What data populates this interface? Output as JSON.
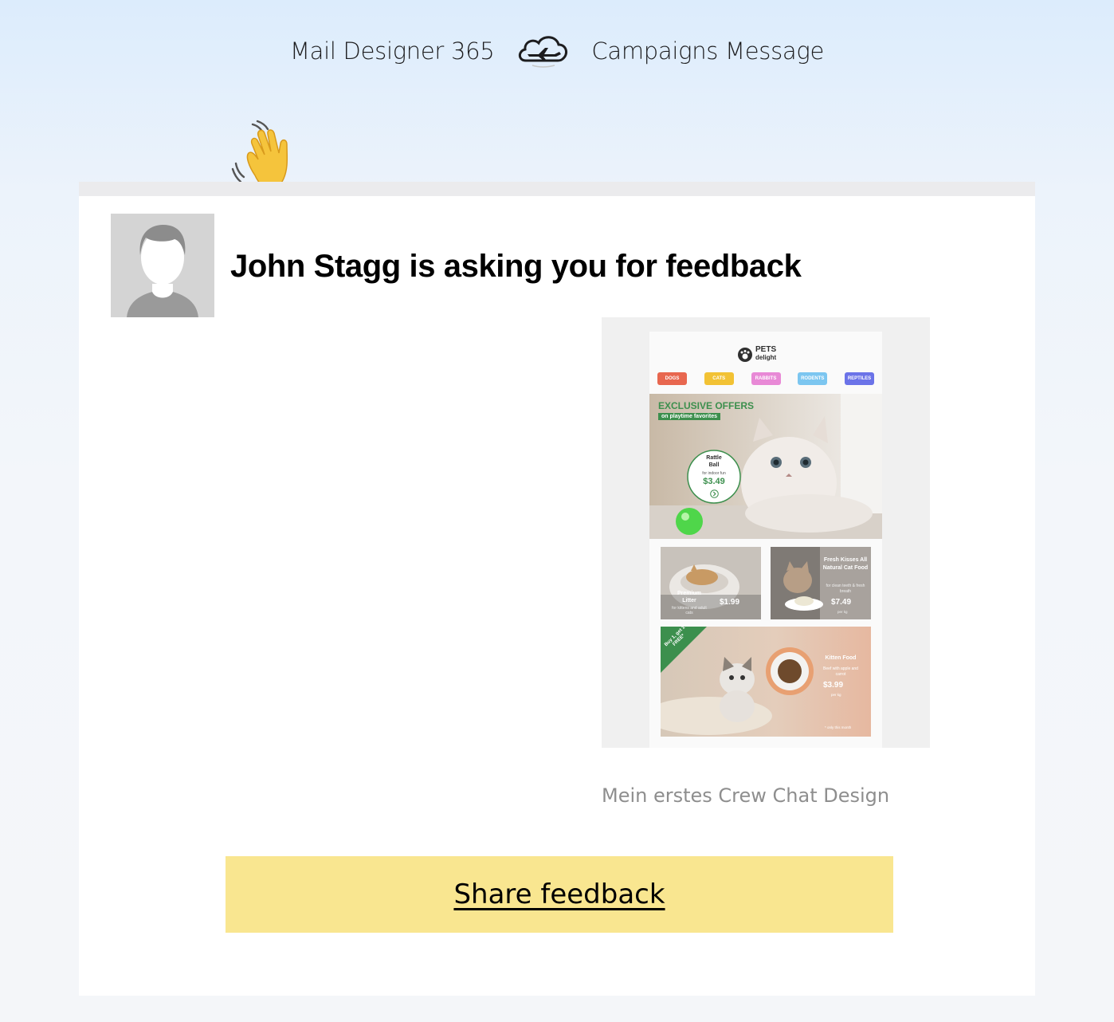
{
  "header": {
    "brand": "Mail Designer 365",
    "logo_icon": "cloud-airplane-icon",
    "product": "Campaigns Message"
  },
  "card": {
    "title": "John Stagg is asking you for feedback",
    "wave_icon": "waving-hand-icon",
    "avatar_icon": "default-user-avatar-icon"
  },
  "preview": {
    "caption": "Mein erstes Crew Chat Design",
    "email": {
      "logo_top": "PETS",
      "logo_bottom": "delight",
      "nav": [
        {
          "label": "DOGS",
          "color": "#e8674f"
        },
        {
          "label": "CATS",
          "color": "#f2c234"
        },
        {
          "label": "RABBITS",
          "color": "#e889d6"
        },
        {
          "label": "RODENTS",
          "color": "#7cc6f0"
        },
        {
          "label": "REPTILES",
          "color": "#6b73e8"
        }
      ],
      "hero": {
        "headline": "EXCLUSIVE OFFERS",
        "subline": "on playtime favorites",
        "product": "Rattle Ball",
        "product_sub": "for indoor fun",
        "price": "$3.49"
      },
      "tile1": {
        "name": "Premium Litter",
        "sub": "for kittens and adult cats",
        "price": "$1.99"
      },
      "tile2": {
        "name": "Fresh Kisses All Natural Cat Food",
        "sub": "for clean teeth & fresh breath",
        "price": "$7.49",
        "unit": "per kg"
      },
      "tile3": {
        "ribbon": "Buy 1, get 1 FREE*",
        "name": "Kitten Food",
        "sub": "Beef with apple and carrot",
        "price": "$3.99",
        "unit": "per kg",
        "note": "* only this month"
      }
    }
  },
  "cta": {
    "label": "Share feedback"
  },
  "colors": {
    "cta_bg": "#f9e690",
    "green": "#3c8f4d"
  }
}
